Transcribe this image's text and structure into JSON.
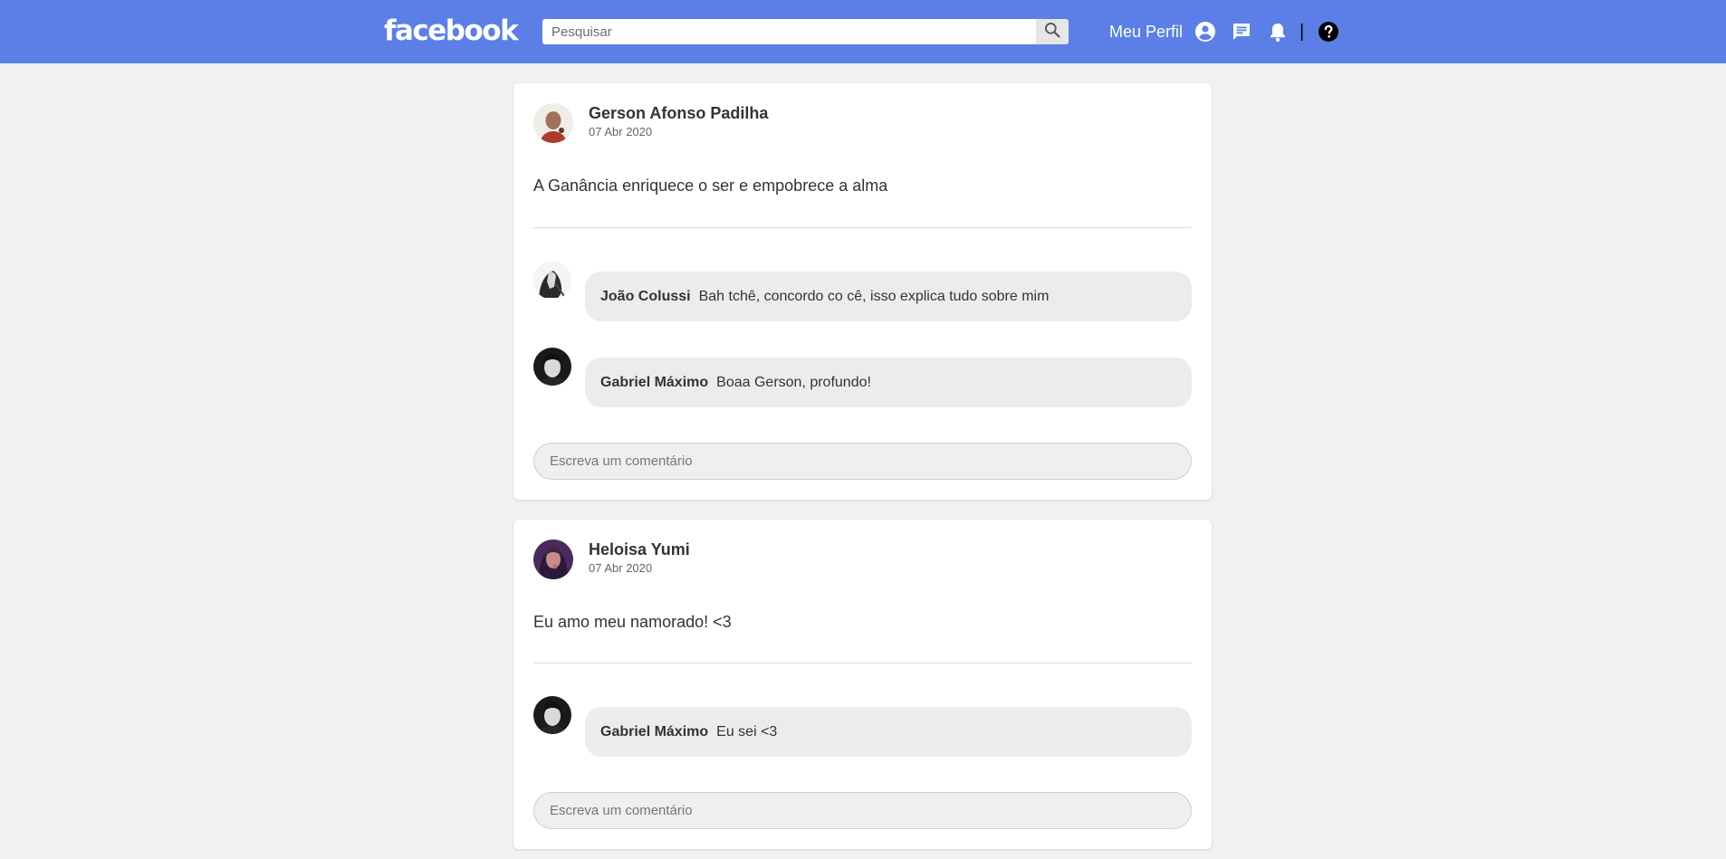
{
  "header": {
    "logo": "facebook",
    "search_placeholder": "Pesquisar",
    "profile_label": "Meu Perfil",
    "separator": "|",
    "icons": [
      "search-icon",
      "account-icon",
      "chat-icon",
      "bell-icon",
      "help-icon"
    ],
    "bar_color": "#5b7fe6"
  },
  "posts": [
    {
      "author": "Gerson Afonso Padilha",
      "date": "07 Abr 2020",
      "text": "A Ganância enriquece o ser e empobrece a alma",
      "comments": [
        {
          "name": "João Colussi",
          "text": "Bah tchê, concordo co cê, isso explica tudo sobre mim"
        },
        {
          "name": "Gabriel Máximo",
          "text": "Boaa Gerson, profundo!"
        }
      ],
      "comment_placeholder": "Escreva um comentário"
    },
    {
      "author": "Heloisa Yumi",
      "date": "07 Abr 2020",
      "text": "Eu amo meu namorado! <3",
      "comments": [
        {
          "name": "Gabriel Máximo",
          "text": "Eu sei <3"
        }
      ],
      "comment_placeholder": "Escreva um comentário"
    }
  ]
}
